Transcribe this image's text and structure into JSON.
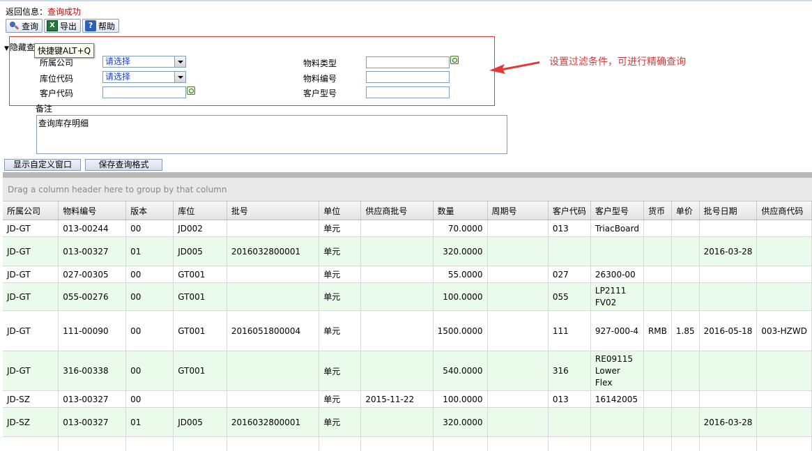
{
  "status": {
    "label": "返回信息：",
    "value": "查询成功"
  },
  "toolbar": {
    "query": "查询",
    "export": "导出",
    "help": "帮助"
  },
  "filter": {
    "collapse_label": "隐藏查",
    "tooltip": "快捷键ALT+Q",
    "company_label": "所属公司",
    "company_value": "请选择",
    "location_label": "库位代码",
    "location_value": "请选择",
    "customer_code_label": "客户代码",
    "material_type_label": "物料类型",
    "material_no_label": "物料编号",
    "customer_model_label": "客户型号"
  },
  "annotation": "设置过滤条件，可进行精确查询",
  "notes": {
    "label": "备注",
    "value": "查询库存明细"
  },
  "buttons": {
    "custom_window": "显示自定义窗口",
    "save_format": "保存查询格式"
  },
  "grid": {
    "group_hint": "Drag a column header here to group by that column",
    "columns": [
      "所属公司",
      "物料编号",
      "版本",
      "库位",
      "批号",
      "单位",
      "供应商批号",
      "数量",
      "周期号",
      "客户代码",
      "客户型号",
      "货币",
      "单价",
      "批号日期",
      "供应商代码"
    ],
    "rows": [
      [
        "JD-GT",
        "013-00244",
        "00",
        "JD002",
        "",
        "单元",
        "",
        "70.0000",
        "",
        "013",
        "TriacBoard",
        "",
        "",
        "",
        ""
      ],
      [
        "JD-GT",
        "013-00327",
        "01",
        "JD005",
        "2016032800001",
        "单元",
        "",
        "320.0000",
        "",
        "",
        "",
        "",
        "",
        "2016-03-28",
        ""
      ],
      [
        "JD-GT",
        "027-00305",
        "00",
        "GT001",
        "",
        "单元",
        "",
        "55.0000",
        "",
        "027",
        "26300-00",
        "",
        "",
        "",
        ""
      ],
      [
        "JD-GT",
        "055-00276",
        "00",
        "GT001",
        "",
        "单元",
        "",
        "100.0000",
        "",
        "055",
        "LP2111\nFV02",
        "",
        "",
        "",
        ""
      ],
      [
        "JD-GT",
        "111-00090",
        "00",
        "GT001",
        "2016051800004",
        "单元",
        "",
        "1500.0000",
        "",
        "111",
        "927-000-4",
        "RMB",
        "1.85",
        "2016-05-18",
        "003-HZWD"
      ],
      [
        "JD-GT",
        "316-00338",
        "00",
        "GT001",
        "",
        "单元",
        "",
        "540.0000",
        "",
        "316",
        "RE09115\nLower\nFlex",
        "",
        "",
        "",
        ""
      ],
      [
        "JD-SZ",
        "013-00327",
        "00",
        "",
        "",
        "单元",
        "2015-11-22",
        "100.0000",
        "",
        "013",
        "16142005",
        "",
        "",
        "",
        ""
      ],
      [
        "JD-SZ",
        "013-00327",
        "01",
        "JD005",
        "2016032800001",
        "单元",
        "",
        "320.0000",
        "",
        "",
        "",
        "",
        "",
        "2016-03-28",
        ""
      ]
    ]
  }
}
